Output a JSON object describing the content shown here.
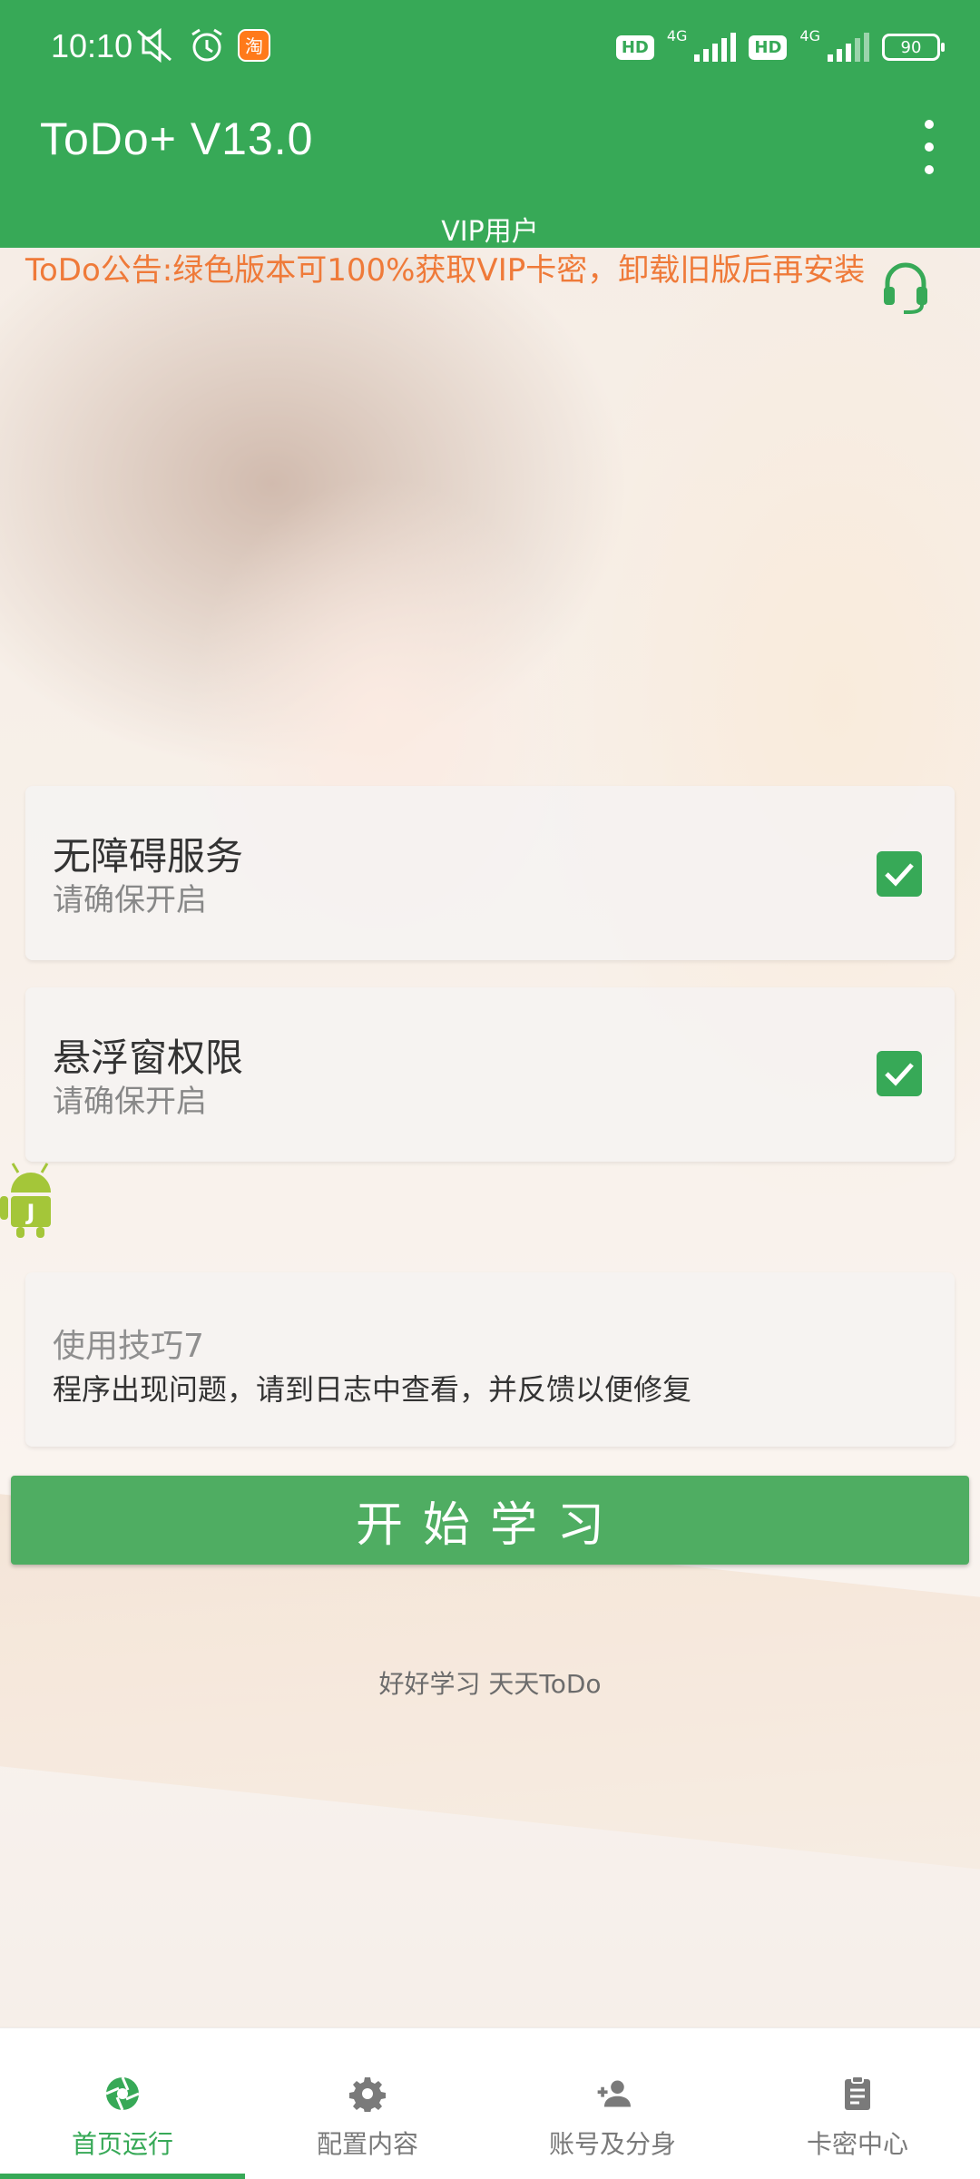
{
  "status_bar": {
    "time": "10:10",
    "hd1": "HD",
    "net1": "4G",
    "hd2": "HD",
    "net2": "4G",
    "battery": "90"
  },
  "app_bar": {
    "title": "ToDo+ V13.0",
    "subtitle": "VIP用户"
  },
  "notice": "ToDo公告:绿色版本可100%获取VIP卡密，卸载旧版后再安装",
  "permissions": [
    {
      "title": "无障碍服务",
      "subtitle": "请确保开启",
      "checked": true
    },
    {
      "title": "悬浮窗权限",
      "subtitle": "请确保开启",
      "checked": true
    }
  ],
  "tip": {
    "title": "使用技巧7",
    "text": "程序出现问题，请到日志中查看，并反馈以便修复"
  },
  "start_button": "开始学习",
  "slogan": "好好学习 天天ToDo",
  "bottom_nav": [
    {
      "label": "首页运行",
      "icon": "aperture-icon",
      "active": true
    },
    {
      "label": "配置内容",
      "icon": "gear-icon",
      "active": false
    },
    {
      "label": "账号及分身",
      "icon": "add-person-icon",
      "active": false
    },
    {
      "label": "卡密中心",
      "icon": "clipboard-icon",
      "active": false
    }
  ],
  "colors": {
    "primary": "#37a957",
    "notice": "#ef7a39"
  }
}
